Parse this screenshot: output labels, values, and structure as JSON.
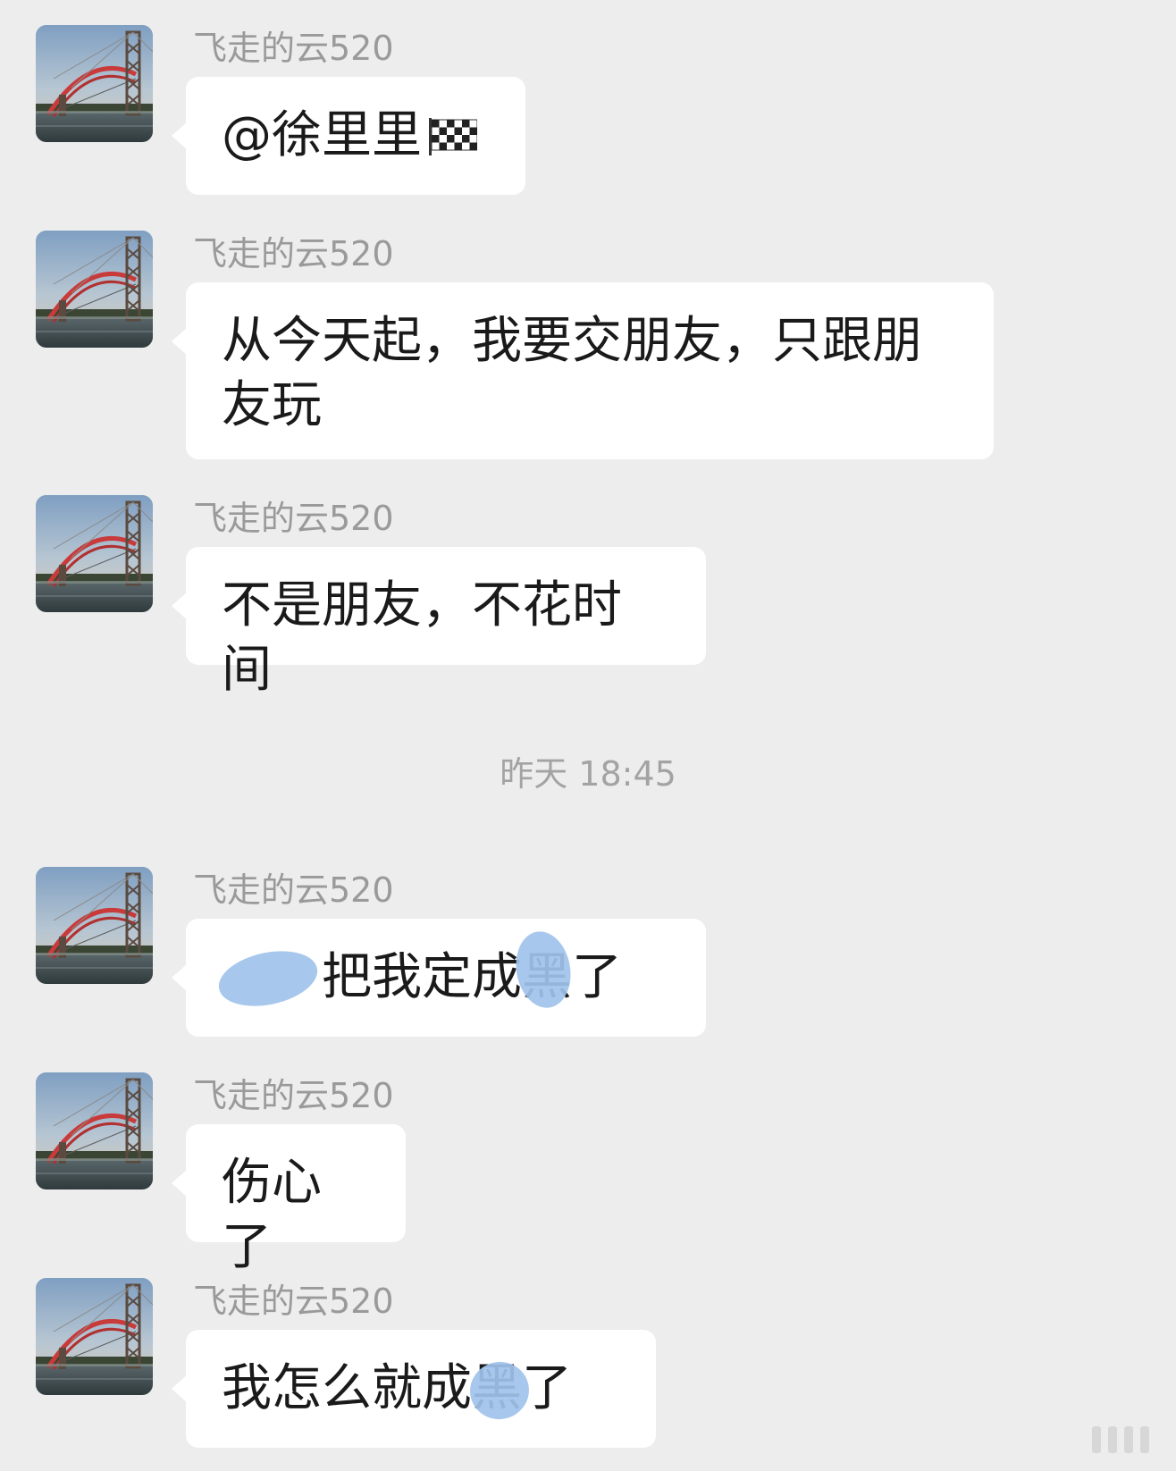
{
  "messages": [
    {
      "sender": "飞走的云520",
      "text": "@徐里里",
      "emoji": "chequered-flag"
    },
    {
      "sender": "飞走的云520",
      "text": "从今天起，我要交朋友，只跟朋友玩"
    },
    {
      "sender": "飞走的云520",
      "text": "不是朋友，不花时间"
    },
    {
      "sender": "飞走的云520",
      "text": "把我定成黑了",
      "redacted": true
    },
    {
      "sender": "飞走的云520",
      "text": "伤心了"
    },
    {
      "sender": "飞走的云520",
      "text": "我怎么就成黑了",
      "redacted": true
    }
  ],
  "timestamp": "昨天 18:45",
  "colors": {
    "background": "#ededed",
    "bubble": "#ffffff",
    "sender_name": "#9a9a9a",
    "redaction": "#9fc2ea"
  }
}
